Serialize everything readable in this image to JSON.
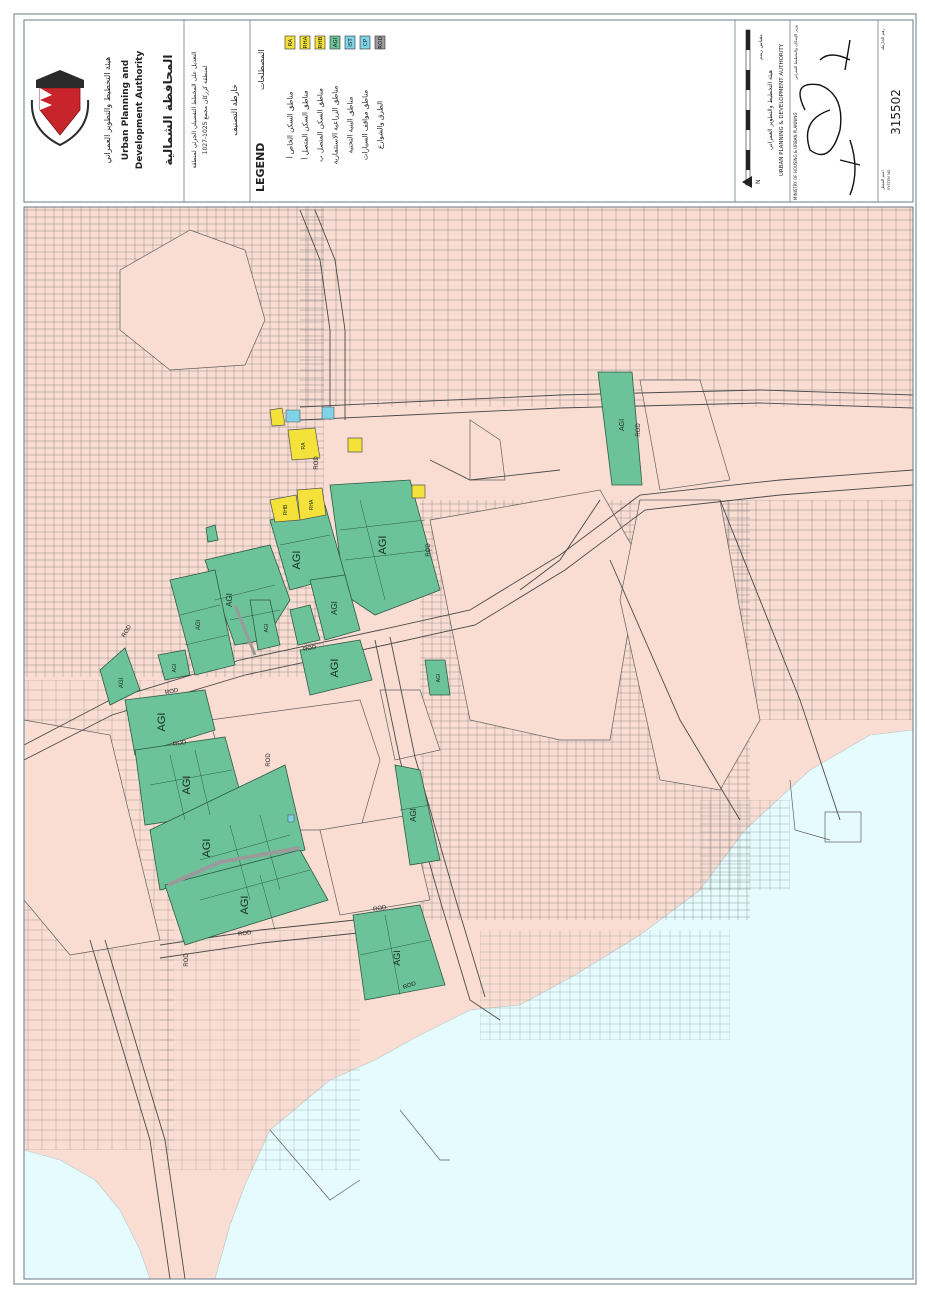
{
  "authority": {
    "arabic_name": "هيئة التخطيط والتطوير العمراني",
    "name_line1": "Urban Planning and",
    "name_line2": "Development Authority"
  },
  "governorate_title": "المحافظة الشمالية",
  "amendment_line1": "التعديل على المخطط التفصيلي الجزئي لمنطقة",
  "amendment_line2": "لمنطقة كرزكان مجمع 1025-1027",
  "map_subtitle": "خارطة التصنيف",
  "legend": {
    "title": "LEGEND",
    "title_ar": "المصطلحات",
    "items": [
      {
        "code": "RA",
        "label": "مناطق السكن الخاص أ",
        "color": "#f4e23a"
      },
      {
        "code": "RHA",
        "label": "مناطق السكن المتصل أ",
        "color": "#f4e23a"
      },
      {
        "code": "RHB",
        "label": "مناطق السكن المتصل ب",
        "color": "#f4e23a"
      },
      {
        "code": "AGI",
        "label": "مناطق الزراعية الاستثمارية",
        "color": "#6cc39a"
      },
      {
        "code": "IST",
        "label": "مناطق البنية التحتية",
        "color": "#7ed3e6"
      },
      {
        "code": "CP",
        "label": "مناطق مواقف السيارات",
        "color": "#7ed3e6"
      },
      {
        "code": "ROD",
        "label": "الطرق والشوارع",
        "color": "#9a9a9a"
      }
    ]
  },
  "scale_label": "مقياس رسم",
  "north_label": "N",
  "footer_ar": "هيئة التخطيط والتطوير العمراني",
  "footer_en": "URBAN PLANNING & DEVELOPMENT AUTHORITY",
  "ministry_label": "MINISTRY OF HOUSING & URBAN PLANNING",
  "ministry_ar": "وزير الإسكان والتخطيط العمراني",
  "signature_label": "اسم الممثل",
  "map_number_label": "رقم الخارطة",
  "system_label": "SYSTEM NO.",
  "map_number": "315502",
  "zone_labels": {
    "agi": "AGI",
    "rha": "RHA",
    "rhb": "RHB",
    "ra": "RA",
    "road": "ROD"
  },
  "colors": {
    "land": "#f9ddd3",
    "sea": "#e5fbfd",
    "agi": "#6cc39a",
    "residential": "#f4e23a",
    "infra": "#7ed3e6"
  }
}
